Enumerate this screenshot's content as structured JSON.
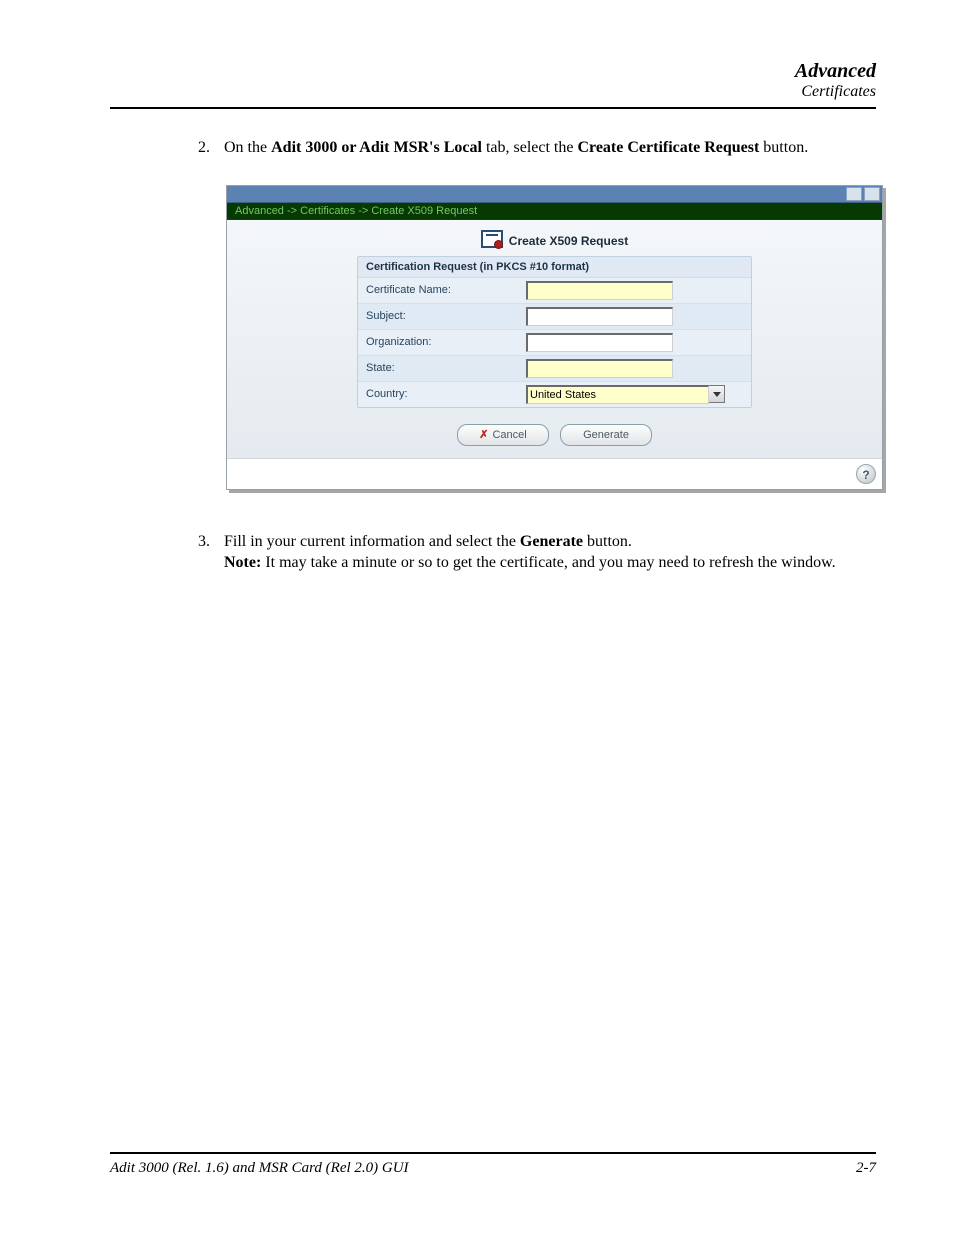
{
  "header": {
    "section_title": "Advanced",
    "section_subtitle": "Certificates"
  },
  "steps": {
    "s2": {
      "num": "2.",
      "text_pre": "On the ",
      "bold1": "Adit 3000 or Adit MSR's Local",
      "text_mid": " tab, select the ",
      "bold2": "Create Certificate Request",
      "text_post": " button."
    },
    "s3": {
      "num": "3.",
      "line1_pre": "Fill in your current information and select the ",
      "line1_bold": "Generate",
      "line1_post": " button.",
      "note_label": "Note:",
      "note_text": " It may take a minute or so to get the certificate, and you may need to refresh the window."
    }
  },
  "screenshot": {
    "breadcrumb": "Advanced -> Certificates -> Create X509 Request",
    "heading": "Create X509 Request",
    "form": {
      "caption": "Certification Request (in PKCS #10 format)",
      "rows": {
        "cert_name_label": "Certificate Name:",
        "cert_name_value": "",
        "subject_label": "Subject:",
        "subject_value": "",
        "org_label": "Organization:",
        "org_value": "",
        "state_label": "State:",
        "state_value": "",
        "country_label": "Country:",
        "country_value": "United States"
      }
    },
    "buttons": {
      "cancel": "Cancel",
      "generate": "Generate"
    },
    "help_tooltip": "?"
  },
  "footer": {
    "doc_title": "Adit 3000 (Rel. 1.6) and MSR Card (Rel 2.0) GUI",
    "page_num": "2-7"
  }
}
